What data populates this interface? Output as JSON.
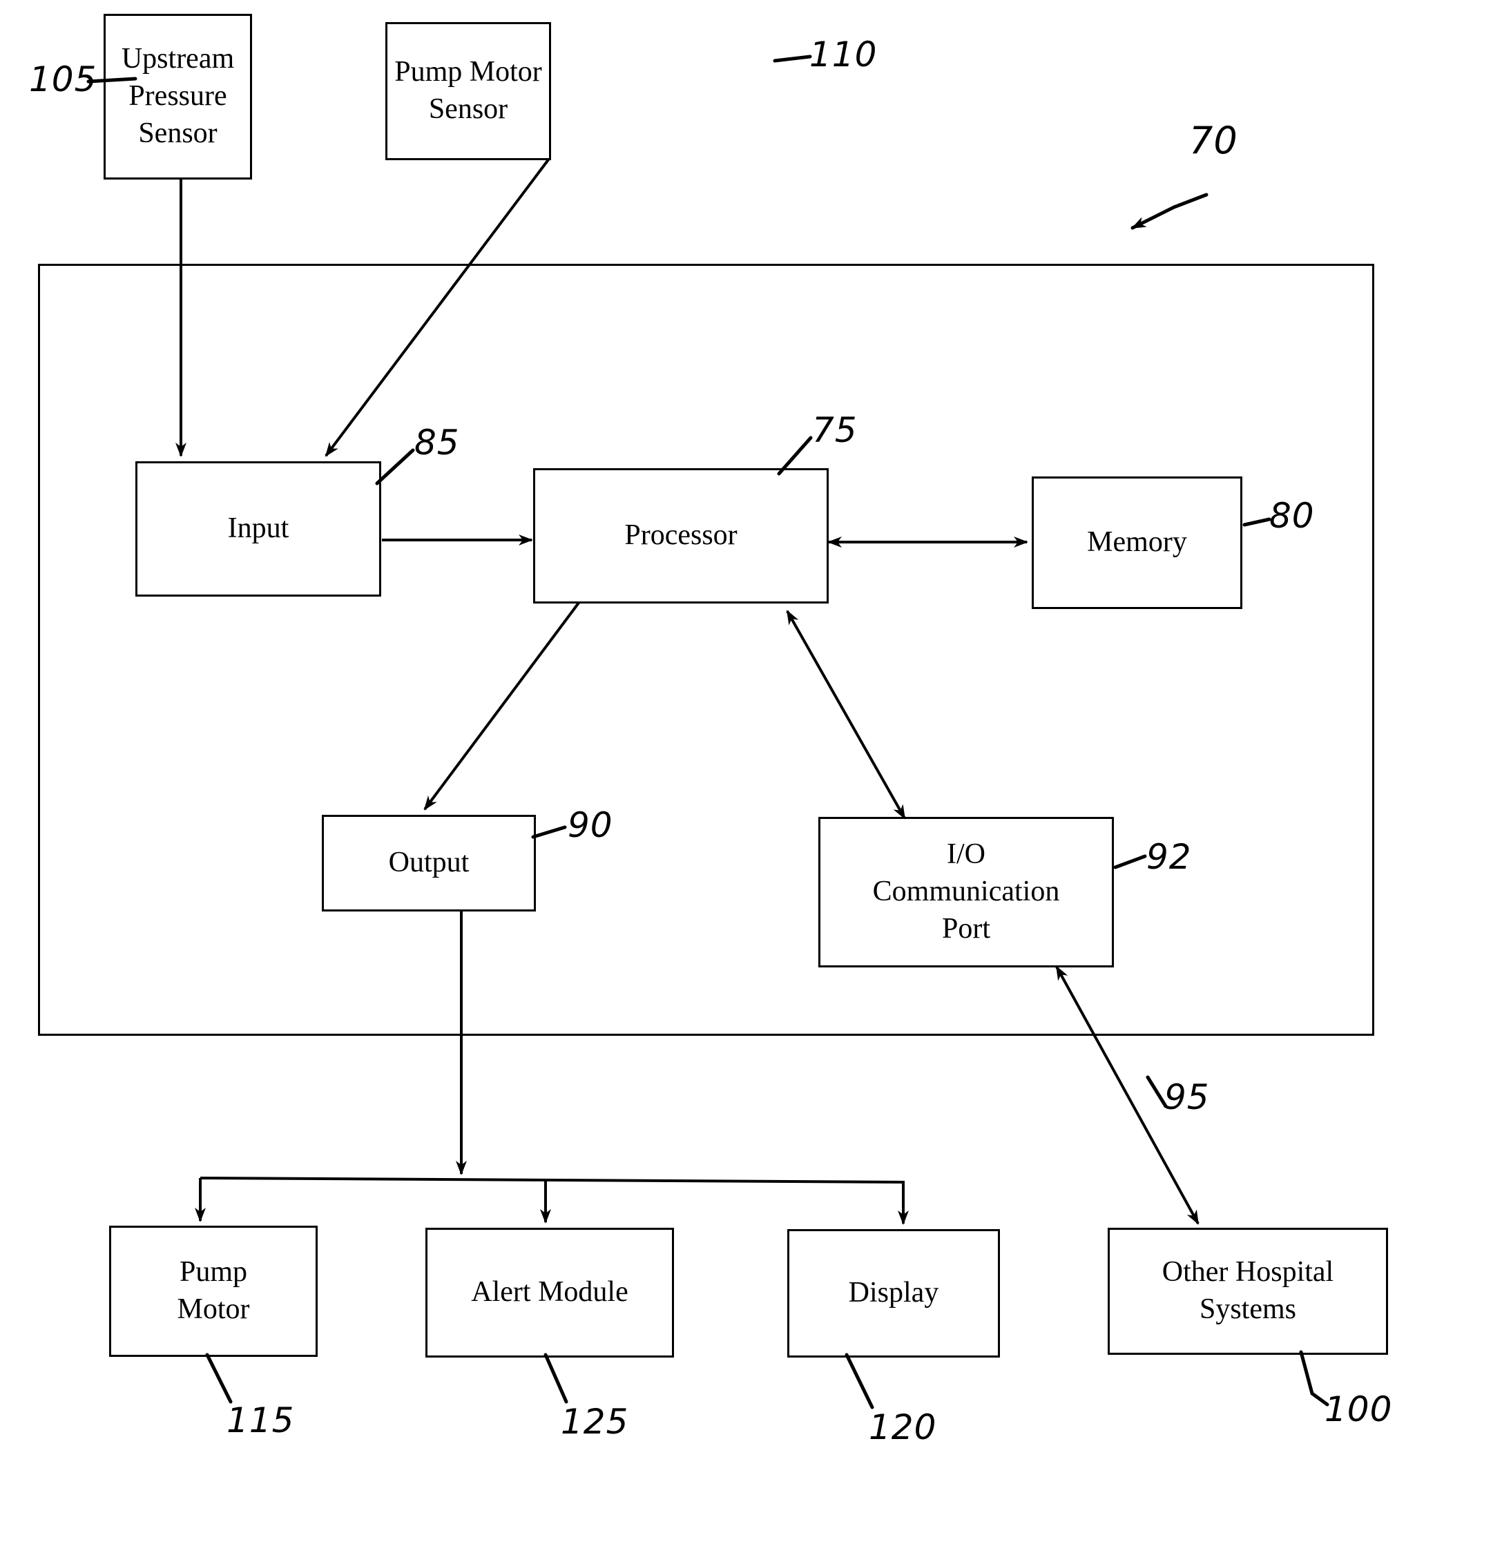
{
  "figure": {
    "type": "patent-block-diagram",
    "subject": "Infusion pump control system block diagram",
    "background_color": "#ffffff",
    "line_color": "#000000"
  },
  "system_boundary": {
    "name": "control-system-boundary",
    "reference_numeral": "70"
  },
  "nodes": {
    "upstream_pressure_sensor": {
      "label": "Upstream\nPressure\nSensor",
      "reference_numeral": "105"
    },
    "pump_motor_sensor": {
      "label": "Pump Motor\nSensor",
      "reference_numeral": "110"
    },
    "input": {
      "label": "Input",
      "reference_numeral": "85"
    },
    "processor": {
      "label": "Processor",
      "reference_numeral": "75"
    },
    "memory": {
      "label": "Memory",
      "reference_numeral": "80"
    },
    "output": {
      "label": "Output",
      "reference_numeral": "90"
    },
    "io_communication_port": {
      "label": "I/O\nCommunication\nPort",
      "reference_numeral": "92"
    },
    "pump_motor": {
      "label": "Pump\nMotor",
      "reference_numeral": "115"
    },
    "alert_module": {
      "label": "Alert Module",
      "reference_numeral": "125"
    },
    "display": {
      "label": "Display",
      "reference_numeral": "120"
    },
    "other_hospital_systems": {
      "label": "Other Hospital\nSystems",
      "reference_numeral": "100"
    }
  },
  "connections": [
    {
      "name": "upstream-pressure-sensor-to-input",
      "from": "upstream_pressure_sensor",
      "to": "input",
      "arrow": "single",
      "reference_numeral": ""
    },
    {
      "name": "pump-motor-sensor-to-input",
      "from": "pump_motor_sensor",
      "to": "input",
      "arrow": "single",
      "reference_numeral": ""
    },
    {
      "name": "input-to-processor",
      "from": "input",
      "to": "processor",
      "arrow": "single",
      "reference_numeral": ""
    },
    {
      "name": "processor-to-memory",
      "from": "processor",
      "to": "memory",
      "arrow": "double",
      "reference_numeral": ""
    },
    {
      "name": "processor-to-output",
      "from": "processor",
      "to": "output",
      "arrow": "single",
      "reference_numeral": ""
    },
    {
      "name": "processor-to-io-port",
      "from": "processor",
      "to": "io_communication_port",
      "arrow": "double",
      "reference_numeral": ""
    },
    {
      "name": "output-to-device-bus",
      "from": "output",
      "to": "device_bus",
      "arrow": "single",
      "reference_numeral": ""
    },
    {
      "name": "bus-to-pump-motor",
      "from": "device_bus",
      "to": "pump_motor",
      "arrow": "single",
      "reference_numeral": ""
    },
    {
      "name": "bus-to-alert-module",
      "from": "device_bus",
      "to": "alert_module",
      "arrow": "single",
      "reference_numeral": ""
    },
    {
      "name": "bus-to-display",
      "from": "device_bus",
      "to": "display",
      "arrow": "single",
      "reference_numeral": ""
    },
    {
      "name": "io-port-to-other-hospital-systems",
      "from": "io_communication_port",
      "to": "other_hospital_systems",
      "arrow": "double",
      "reference_numeral": "95"
    }
  ]
}
